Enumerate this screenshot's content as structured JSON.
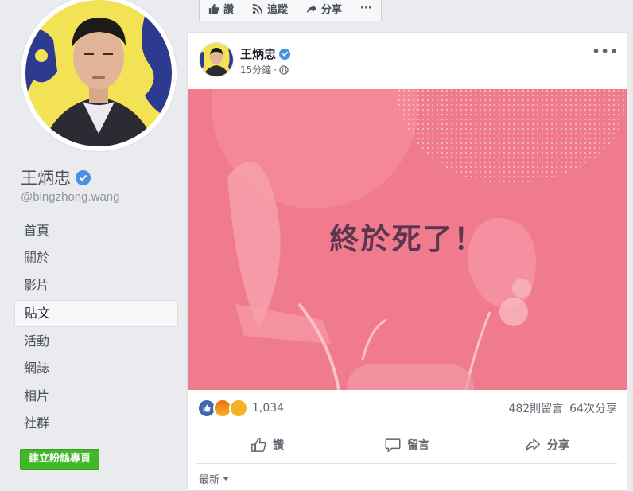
{
  "profile": {
    "name": "王炳忠",
    "handle": "@bingzhong.wang",
    "avatar_icon": "profile-photo"
  },
  "nav": {
    "items": [
      {
        "label": "首頁",
        "active": false
      },
      {
        "label": "關於",
        "active": false
      },
      {
        "label": "影片",
        "active": false
      },
      {
        "label": "貼文",
        "active": true
      },
      {
        "label": "活動",
        "active": false
      },
      {
        "label": "網誌",
        "active": false
      },
      {
        "label": "相片",
        "active": false
      },
      {
        "label": "社群",
        "active": false
      }
    ],
    "create_page_label": "建立粉絲專頁"
  },
  "top_actions": {
    "like_label": "讚",
    "follow_label": "追蹤",
    "share_label": "分享",
    "more_label": "···"
  },
  "post": {
    "author": "王炳忠",
    "time": "15分鐘",
    "menu_label": "•••",
    "image_text": "終於死了！",
    "reaction_count": "1,034",
    "comments": "482則留言",
    "shares": "64次分享",
    "like_label": "讚",
    "comment_label": "留言",
    "share_label": "分享",
    "sort_label": "最新"
  },
  "colors": {
    "verified": "#4a90e2",
    "image_bg": "#f07b8d",
    "image_text": "#5b3551",
    "create_button": "#42b72a"
  }
}
